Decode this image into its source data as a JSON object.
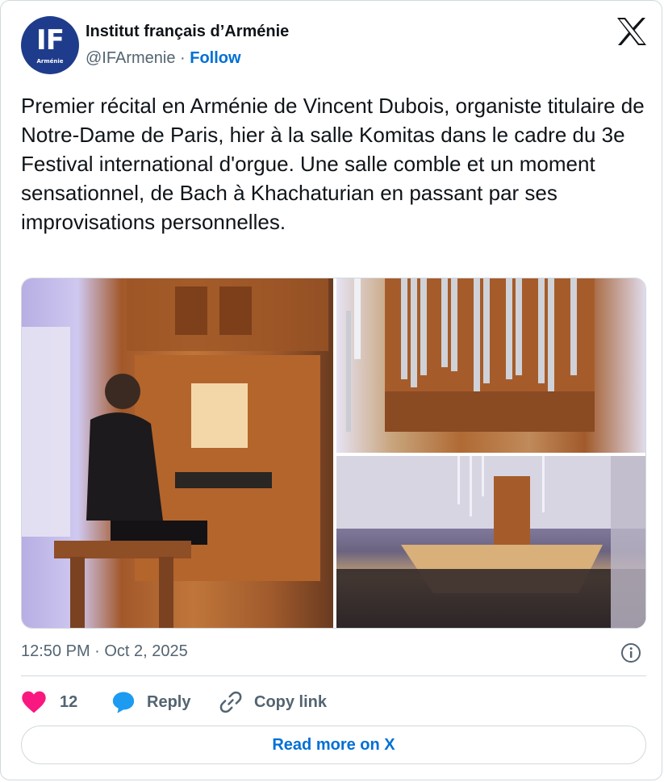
{
  "author": {
    "name": "Institut français d’Arménie",
    "handle": "@IFArmenie",
    "separator": "·",
    "follow_label": "Follow",
    "avatar_monogram": "IF",
    "avatar_subtitle": "Arménie"
  },
  "tweet": {
    "text": "Premier récital en Arménie de Vincent Dubois, organiste titulaire de Notre-Dame de Paris, hier à la salle Komitas dans le cadre du 3e Festival international d'orgue. Une salle comble et un moment sensationnel, de Bach à Khachaturian en passant par ses improvisations personnelles.",
    "timestamp": "12:50 PM · Oct 2, 2025"
  },
  "media": {
    "photos": [
      {
        "name": "organist-at-console-photo"
      },
      {
        "name": "organ-pipes-photo"
      },
      {
        "name": "concert-hall-photo"
      }
    ]
  },
  "actions": {
    "like_count": "12",
    "reply_label": "Reply",
    "copy_link_label": "Copy link"
  },
  "read_more_label": "Read more on X",
  "colors": {
    "accent_blue": "#006fd6",
    "like_pink": "#f91880",
    "reply_blue": "#1d9bf0",
    "muted": "#536471",
    "border": "#cfd9de"
  },
  "icons": [
    "x-logo-icon",
    "info-icon",
    "heart-icon",
    "reply-bubble-icon",
    "link-icon"
  ]
}
